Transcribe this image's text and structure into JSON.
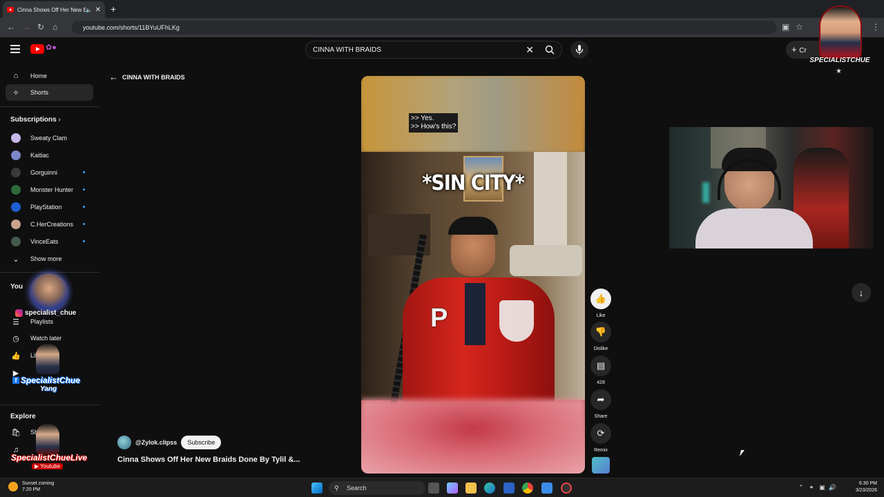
{
  "browser": {
    "tab_title": "Cinna Shows Off Her New B",
    "url": "youtube.com/shorts/11BYuUFhLKg"
  },
  "masthead": {
    "search_query": "CINNA WITH BRAIDS",
    "create_label": "Cr"
  },
  "sidebar": {
    "top": [
      {
        "label": "Home",
        "icon": "home-icon"
      },
      {
        "label": "Shorts",
        "icon": "shorts-icon",
        "active": true
      }
    ],
    "subscriptions_title": "Subscriptions",
    "subscriptions": [
      {
        "label": "Sweaty Clam",
        "color": "#c7b7e6",
        "new": false
      },
      {
        "label": "Kaitiac",
        "color": "#7a88c9",
        "new": false
      },
      {
        "label": "Gorguinni",
        "color": "#3a3a3a",
        "new": true
      },
      {
        "label": "Monster Hunter",
        "color": "#2c6a3b",
        "new": true
      },
      {
        "label": "PlayStation",
        "color": "#1e5fd1",
        "new": true
      },
      {
        "label": "C.HerCreations",
        "color": "#c9a48c",
        "new": true
      },
      {
        "label": "VinceEats",
        "color": "#445a4a",
        "new": true
      }
    ],
    "show_more": "Show more",
    "you_title": "You",
    "you_items": [
      {
        "label": "Playlists",
        "icon": "playlist-icon"
      },
      {
        "label": "Watch later",
        "icon": "clock-icon"
      },
      {
        "label": "Lik    os",
        "icon": "thumbs-up-icon"
      }
    ],
    "explore_title": "Explore",
    "explore_items": [
      {
        "label": "Sh",
        "icon": "shopping-bag-icon"
      }
    ]
  },
  "overlays": {
    "instagram_handle": "specialist_chue",
    "facebook_name_1": "SpecialistChue",
    "facebook_name_2": "Yang",
    "youtube_name": "SpecialistChueLive",
    "youtube_word": "Youtube",
    "top_logo_name": "SPECIALISTCHUE"
  },
  "main": {
    "back_label": "CINNA WITH BRAIDS",
    "caption_line1": ">> Yes.",
    "caption_line2": ">> How's this?",
    "overlay_text": "*SIN CITY*",
    "channel": "@Zylok.clipss",
    "subscribe": "Subscribe",
    "title": "Cinna Shows Off Her New Braids Done By Tylil &..."
  },
  "actions": {
    "like": "Like",
    "dislike": "Dislike",
    "comments": "428",
    "share": "Share",
    "remix": "Remix"
  },
  "taskbar": {
    "weather_line1": "Sunset coming",
    "weather_line2": "7:20 PM",
    "search": "Search",
    "time": "6:30 PM",
    "date": "3/23/2026"
  }
}
